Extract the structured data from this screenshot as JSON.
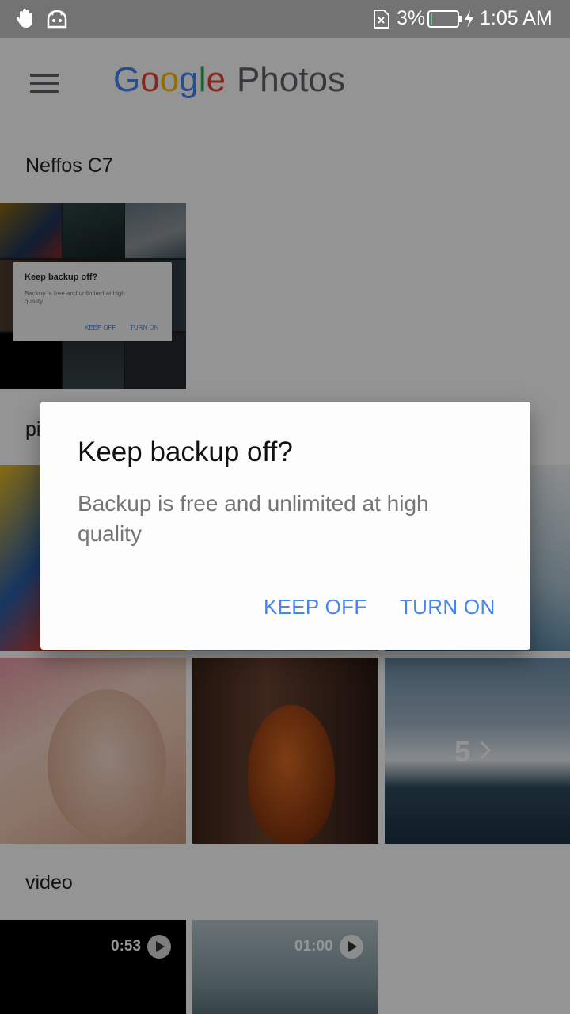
{
  "status_bar": {
    "battery": "3%",
    "time": "1:05 AM"
  },
  "app_bar": {
    "logo_letters": [
      {
        "ch": "G",
        "color": "#4285f4"
      },
      {
        "ch": "o",
        "color": "#ea4335"
      },
      {
        "ch": "o",
        "color": "#fbbc05"
      },
      {
        "ch": "g",
        "color": "#4285f4"
      },
      {
        "ch": "l",
        "color": "#34a853"
      },
      {
        "ch": "e",
        "color": "#ea4335"
      }
    ],
    "product": "Photos"
  },
  "sections": {
    "device": "Neffos C7",
    "picture": "picture",
    "video": "video"
  },
  "thumbnail_dialog": {
    "title": "Keep backup off?",
    "body": "Backup is free and unlimited at high quality",
    "keep_off": "KEEP OFF",
    "turn_on": "TURN ON"
  },
  "picture_grid": {
    "more_count": "5"
  },
  "videos": [
    {
      "duration": "0:53"
    },
    {
      "duration": "01:00"
    }
  ],
  "dialog": {
    "title": "Keep backup off?",
    "body": "Backup is free and unlimited at high quality",
    "keep_off": "KEEP OFF",
    "turn_on": "TURN ON",
    "accent": "#4285f4"
  }
}
